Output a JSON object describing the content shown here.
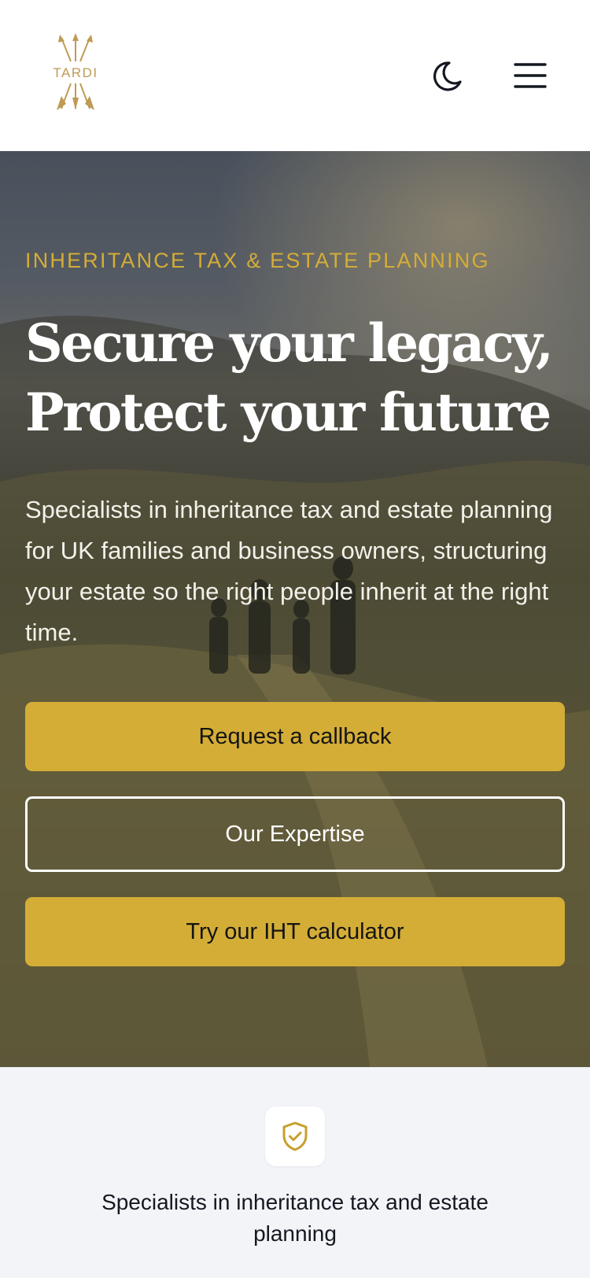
{
  "header": {
    "logo_text": "TARDI",
    "logo_icon": "arrows-logo",
    "theme_toggle_icon": "moon-icon",
    "menu_icon": "hamburger-menu-icon"
  },
  "hero": {
    "eyebrow": "INHERITANCE TAX & ESTATE PLANNING",
    "headline_line1": "Secure your legacy,",
    "headline_line2": "Protect your future",
    "lead": "Specialists in inheritance tax and estate planning for UK families and business owners, structuring your estate so the right people inherit at the right time.",
    "buttons": {
      "callback": "Request a callback",
      "expertise": "Our Expertise",
      "calculator": "Try our IHT calculator"
    }
  },
  "features": {
    "items": [
      {
        "icon": "shield-check-icon",
        "text": "Specialists in inheritance tax and estate planning"
      }
    ]
  },
  "colors": {
    "accent_gold": "#d4ad37",
    "text_dark": "#141821",
    "feature_bg": "#f3f4f8",
    "header_bg": "#ffffff"
  }
}
